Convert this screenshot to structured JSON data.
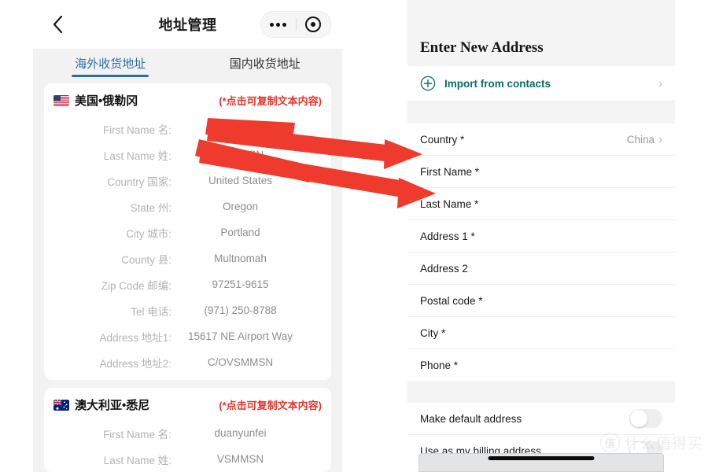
{
  "left_panel": {
    "nav": {
      "back_icon": "chevron-left-icon",
      "title": "地址管理",
      "more_icon": "more-dots-icon",
      "target_icon": "target-circle-icon"
    },
    "tabs": [
      {
        "label": "海外收货地址",
        "active": true
      },
      {
        "label": "国内收货地址",
        "active": false
      }
    ],
    "cards": [
      {
        "flag": "us-flag-icon",
        "title": "美国•俄勒冈",
        "copy_hint": "(*点击可复制文本内容)",
        "rows": [
          {
            "key": "First Name 名:",
            "value": ""
          },
          {
            "key": "Last Name 姓:",
            "value": "VSMMSN"
          },
          {
            "key": "Country 国家:",
            "value": "United States"
          },
          {
            "key": "State 州:",
            "value": "Oregon"
          },
          {
            "key": "City 城市:",
            "value": "Portland"
          },
          {
            "key": "County 县:",
            "value": "Multnomah"
          },
          {
            "key": "Zip Code 邮编:",
            "value": "97251-9615"
          },
          {
            "key": "Tel 电话:",
            "value": "(971) 250-8788"
          },
          {
            "key": "Address 地址1:",
            "value": "15617 NE Airport Way"
          },
          {
            "key": "Address 地址2:",
            "value": "C/OVSMMSN"
          }
        ]
      },
      {
        "flag": "au-flag-icon",
        "title": "澳大利亚•悉尼",
        "copy_hint": "(*点击可复制文本内容)",
        "rows": [
          {
            "key": "First Name 名:",
            "value": "duanyunfei"
          },
          {
            "key": "Last Name 姓:",
            "value": "VSMMSN"
          }
        ]
      }
    ]
  },
  "right_panel": {
    "title": "Enter New Address",
    "import": {
      "icon": "plus-circle-icon",
      "label": "Import from contacts",
      "chevron": "chevron-right-icon"
    },
    "fields": [
      {
        "label": "Country *",
        "value": "China",
        "has_chevron": true
      },
      {
        "label": "First Name *",
        "value": "",
        "has_chevron": false
      },
      {
        "label": "Last Name *",
        "value": "",
        "has_chevron": false
      },
      {
        "label": "Address 1 *",
        "value": "",
        "has_chevron": false
      },
      {
        "label": "Address 2",
        "value": "",
        "has_chevron": false
      },
      {
        "label": "Postal code *",
        "value": "",
        "has_chevron": false
      },
      {
        "label": "City *",
        "value": "",
        "has_chevron": false
      },
      {
        "label": "Phone *",
        "value": "",
        "has_chevron": false
      }
    ],
    "toggles": [
      {
        "label": "Make default address",
        "on": false
      },
      {
        "label": "Use as my billing address",
        "on": false
      }
    ]
  },
  "annotations": {
    "arrow_color": "#ee3b2e",
    "arrows": [
      {
        "name": "arrow-first-name",
        "from": "left first name value",
        "to": "right First Name field"
      },
      {
        "name": "arrow-last-name",
        "from": "left last name value",
        "to": "right Last Name field"
      }
    ]
  },
  "watermark": {
    "logo_text": "值",
    "text": "什么值得买"
  }
}
